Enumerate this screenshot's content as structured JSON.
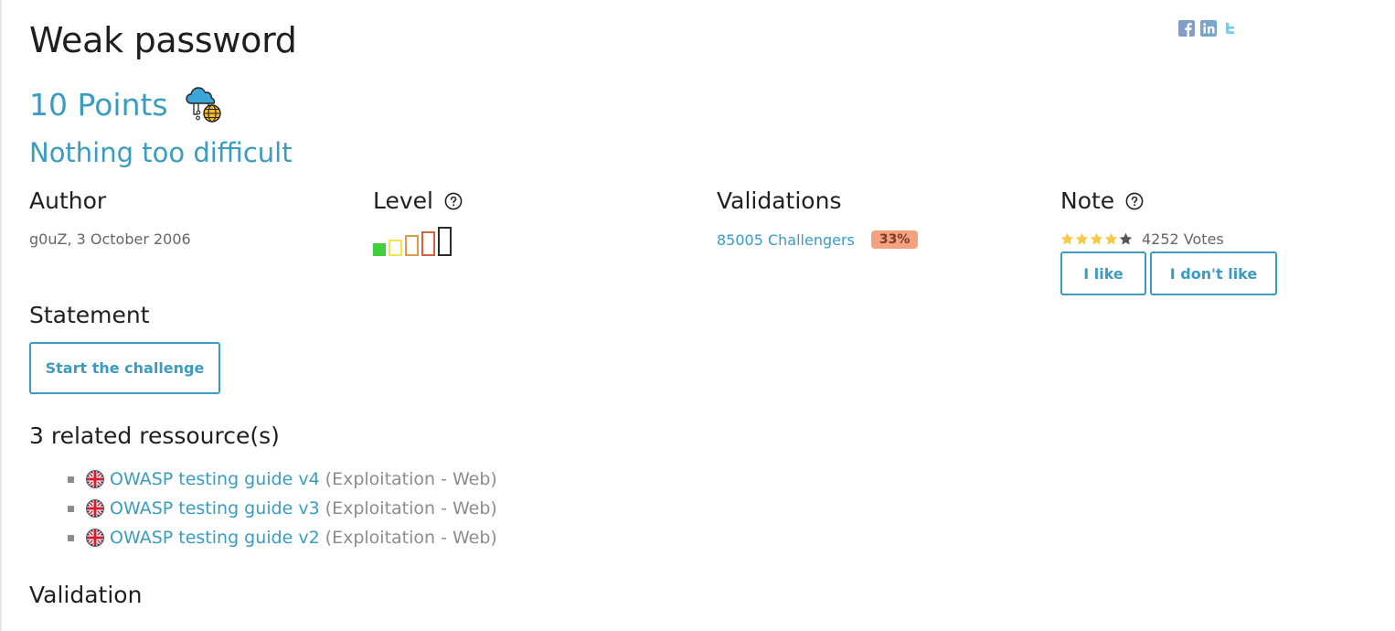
{
  "challenge": {
    "title": "Weak password",
    "points": "10 Points",
    "category_icon": "cloud-network-icon",
    "subtitle": "Nothing too difficult"
  },
  "social": [
    {
      "name": "facebook-icon",
      "color": "#5b7bb5"
    },
    {
      "name": "linkedin-icon",
      "color": "#4b88b8"
    },
    {
      "name": "twitter-icon",
      "color": "#55c4ef"
    }
  ],
  "author": {
    "heading": "Author",
    "text": "g0uZ,  3 October 2006"
  },
  "level": {
    "heading": "Level",
    "value": 1,
    "max": 5,
    "colors": [
      "#3fcf3f",
      "#f0e84a",
      "#e09a4a",
      "#d8603c",
      "#2b2b2b"
    ]
  },
  "validations": {
    "heading": "Validations",
    "challengers": "85005 Challengers",
    "percent": "33%"
  },
  "note": {
    "heading": "Note",
    "rating": 4,
    "max": 5,
    "votes": "4252 Votes",
    "like_label": "I like",
    "dislike_label": "I don't like"
  },
  "statement": {
    "heading": "Statement",
    "start_label": "Start the challenge"
  },
  "resources": {
    "heading": "3 related ressource(s)",
    "items": [
      {
        "title": "OWASP testing guide v4",
        "category": "(Exploitation - Web)",
        "flag": "uk-flag-icon"
      },
      {
        "title": "OWASP testing guide v3",
        "category": "(Exploitation - Web)",
        "flag": "uk-flag-icon"
      },
      {
        "title": "OWASP testing guide v2",
        "category": "(Exploitation - Web)",
        "flag": "uk-flag-icon"
      }
    ]
  },
  "validation": {
    "heading": "Validation"
  },
  "colors": {
    "accent": "#3a9cc0",
    "star_on": "#f2c94c",
    "star_off": "#555555",
    "badge": "#f4a27e"
  }
}
